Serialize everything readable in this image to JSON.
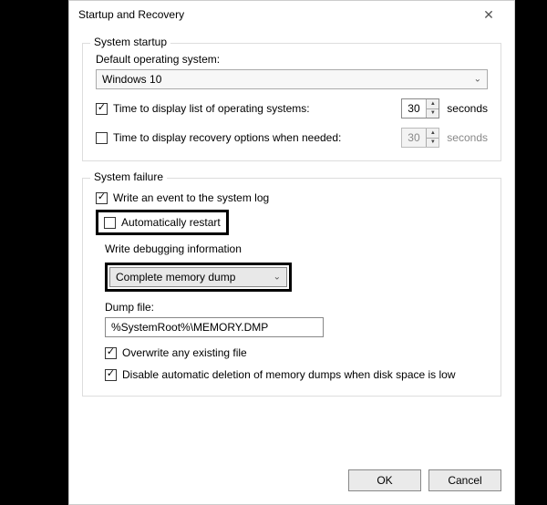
{
  "titlebar": {
    "title": "Startup and Recovery"
  },
  "startup": {
    "group_label": "System startup",
    "default_os_label": "Default operating system:",
    "default_os_value": "Windows 10",
    "display_list_label": "Time to display list of operating systems:",
    "display_list_value": "30",
    "display_recovery_label": "Time to display recovery options when needed:",
    "display_recovery_value": "30",
    "seconds_label": "seconds"
  },
  "failure": {
    "group_label": "System failure",
    "write_event_label": "Write an event to the system log",
    "auto_restart_label": "Automatically restart",
    "debug_heading": "Write debugging information",
    "debug_select_value": "Complete memory dump",
    "dump_file_label": "Dump file:",
    "dump_file_value": "%SystemRoot%\\MEMORY.DMP",
    "overwrite_label": "Overwrite any existing file",
    "disable_deletion_label": "Disable automatic deletion of memory dumps when disk space is low"
  },
  "buttons": {
    "ok": "OK",
    "cancel": "Cancel"
  }
}
